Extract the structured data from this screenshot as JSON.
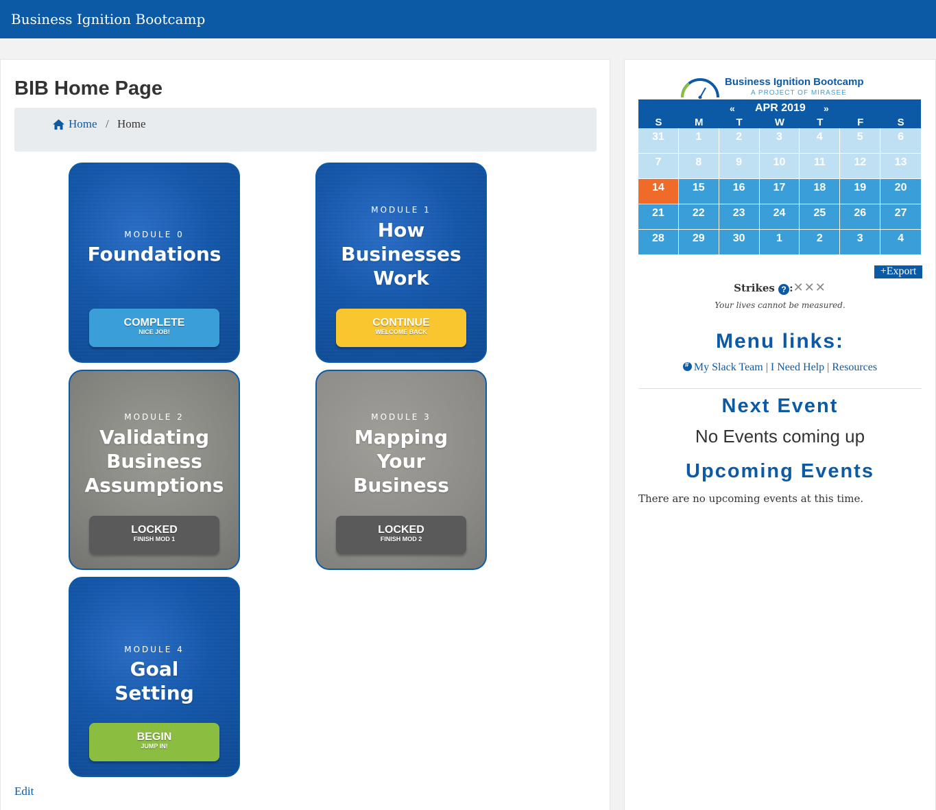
{
  "header": {
    "site_title": "Business Ignition Bootcamp"
  },
  "main": {
    "page_title": "BIB Home Page",
    "breadcrumb": {
      "home_label": "Home",
      "separator": "/",
      "current": "Home"
    },
    "modules": [
      {
        "label": "MODULE 0",
        "title": "Foundations",
        "button_main": "COMPLETE",
        "button_sub": "NICE JOB!",
        "button_color": "#3a9fd8"
      },
      {
        "label": "MODULE 1",
        "title": "How Businesses Work",
        "button_main": "CONTINUE",
        "button_sub": "WELCOME BACK",
        "button_color": "#f9c630"
      },
      {
        "label": "MODULE 2",
        "title": "Validating Business Assumptions",
        "button_main": "LOCKED",
        "button_sub": "FINISH MOD 1",
        "button_color": "#5a5a5a"
      },
      {
        "label": "MODULE 3",
        "title": "Mapping Your Business",
        "button_main": "LOCKED",
        "button_sub": "FINISH MOD 2",
        "button_color": "#5a5a5a"
      },
      {
        "label": "MODULE 4",
        "title": "Goal Setting",
        "button_main": "BEGIN",
        "button_sub": "JUMP IN!",
        "button_color": "#8abd40"
      }
    ],
    "edit_label": "Edit"
  },
  "sidebar": {
    "logo": {
      "line1": "Business Ignition Bootcamp",
      "line2": "A PROJECT OF MIRASEE"
    },
    "calendar": {
      "prev": "«",
      "month": "APR 2019",
      "next": "»",
      "days_of_week": [
        "S",
        "M",
        "T",
        "W",
        "T",
        "F",
        "S"
      ],
      "days": [
        {
          "d": "31",
          "s": "past"
        },
        {
          "d": "1",
          "s": "past"
        },
        {
          "d": "2",
          "s": "past"
        },
        {
          "d": "3",
          "s": "past"
        },
        {
          "d": "4",
          "s": "past"
        },
        {
          "d": "5",
          "s": "past"
        },
        {
          "d": "6",
          "s": "past"
        },
        {
          "d": "7",
          "s": "past"
        },
        {
          "d": "8",
          "s": "past"
        },
        {
          "d": "9",
          "s": "past"
        },
        {
          "d": "10",
          "s": "past"
        },
        {
          "d": "11",
          "s": "past"
        },
        {
          "d": "12",
          "s": "past"
        },
        {
          "d": "13",
          "s": "past"
        },
        {
          "d": "14",
          "s": "today"
        },
        {
          "d": "15",
          "s": "future"
        },
        {
          "d": "16",
          "s": "future"
        },
        {
          "d": "17",
          "s": "future"
        },
        {
          "d": "18",
          "s": "future"
        },
        {
          "d": "19",
          "s": "future"
        },
        {
          "d": "20",
          "s": "future"
        },
        {
          "d": "21",
          "s": "future"
        },
        {
          "d": "22",
          "s": "future"
        },
        {
          "d": "23",
          "s": "future"
        },
        {
          "d": "24",
          "s": "future"
        },
        {
          "d": "25",
          "s": "future"
        },
        {
          "d": "26",
          "s": "future"
        },
        {
          "d": "27",
          "s": "future"
        },
        {
          "d": "28",
          "s": "future"
        },
        {
          "d": "29",
          "s": "future"
        },
        {
          "d": "30",
          "s": "future"
        },
        {
          "d": "1",
          "s": "future"
        },
        {
          "d": "2",
          "s": "future"
        },
        {
          "d": "3",
          "s": "future"
        },
        {
          "d": "4",
          "s": "future"
        }
      ]
    },
    "export_label": "+Export",
    "strikes": {
      "label": "Strikes",
      "help_icon": "?",
      "colon": ":",
      "marks": "✕✕✕",
      "note": "Your lives cannot be measured."
    },
    "menu_links": {
      "heading": "Menu links:",
      "slack": "My Slack Team",
      "sep": "|",
      "help": "I Need Help",
      "resources": "Resources"
    },
    "next_event": {
      "heading": "Next Event",
      "text": "No Events coming up"
    },
    "upcoming": {
      "heading": "Upcoming Events",
      "text": "There are no upcoming events at this time."
    }
  },
  "colors": {
    "brand_blue": "#0c5aa6",
    "today": "#f06a2a",
    "cal_future": "#3a9fd8",
    "cal_past": "#bfe0f2"
  }
}
